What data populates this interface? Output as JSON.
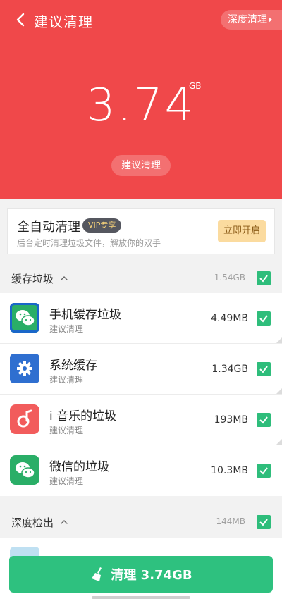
{
  "header": {
    "title": "建议清理",
    "deep_clean_label": "深度清理",
    "total_value": "3.74",
    "total_unit": "GB",
    "suggest_label": "建议清理",
    "bg_color": "#f0484a"
  },
  "auto_clean": {
    "title": "全自动清理",
    "vip_badge": "VIP专享",
    "subtitle": "后台定时清理垃圾文件，解放你的双手",
    "button_label": "立即开启"
  },
  "cache_section": {
    "title": "缓存垃圾",
    "size": "1.54GB",
    "checked": true,
    "items": [
      {
        "title": "手机缓存垃圾",
        "subtitle": "建议清理",
        "size": "4.49MB",
        "icon": "wechat-icon",
        "checked": true
      },
      {
        "title": "系统缓存",
        "subtitle": "建议清理",
        "size": "1.34GB",
        "icon": "gear-icon",
        "checked": true
      },
      {
        "title": "i 音乐的垃圾",
        "subtitle": "建议清理",
        "size": "193MB",
        "icon": "music-note-icon",
        "checked": true
      },
      {
        "title": "微信的垃圾",
        "subtitle": "建议清理",
        "size": "10.3MB",
        "icon": "wechat-icon",
        "checked": true
      }
    ]
  },
  "deep_section": {
    "title": "深度检出",
    "size": "144MB",
    "checked": true
  },
  "cta": {
    "label": "清理 3.74GB",
    "icon": "broom-icon",
    "color": "#2ec17f"
  },
  "colors": {
    "accent_green": "#2ebd7b",
    "vip_gold": "#f6d27a",
    "open_btn": "#fbdb9f"
  }
}
